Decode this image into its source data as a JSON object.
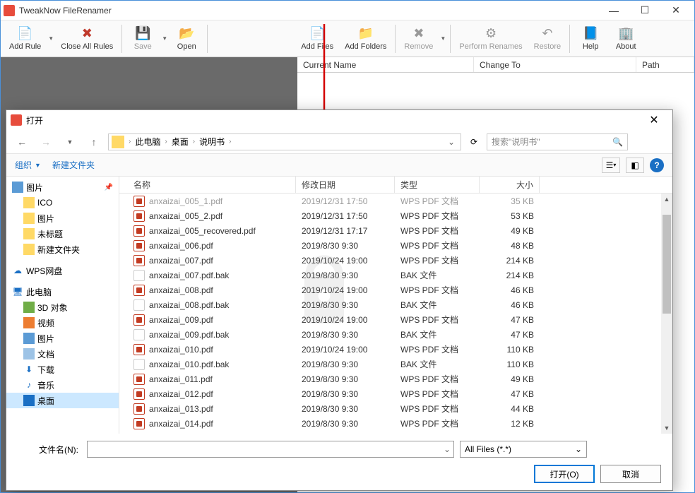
{
  "app": {
    "title": "TweakNow FileRenamer"
  },
  "toolbar": {
    "add_rule": "Add Rule",
    "close_all": "Close All Rules",
    "save": "Save",
    "open": "Open",
    "add_files": "Add Files",
    "add_folders": "Add Folders",
    "remove": "Remove",
    "perform": "Perform Renames",
    "restore": "Restore",
    "help": "Help",
    "about": "About"
  },
  "columns": {
    "current_name": "Current Name",
    "change_to": "Change To",
    "path": "Path"
  },
  "dialog": {
    "title": "打开",
    "breadcrumb": [
      "此电脑",
      "桌面",
      "说明书"
    ],
    "search_placeholder": "搜索\"说明书\"",
    "organize": "组织",
    "new_folder": "新建文件夹",
    "sidebar": {
      "pictures_pin": "图片",
      "ico": "ICO",
      "pictures": "图片",
      "untitled": "未标题",
      "new_folder": "新建文件夹",
      "wps": "WPS网盘",
      "this_pc": "此电脑",
      "objects3d": "3D 对象",
      "videos": "视频",
      "pictures2": "图片",
      "documents": "文档",
      "downloads": "下载",
      "music": "音乐",
      "desktop": "桌面"
    },
    "headers": {
      "name": "名称",
      "date": "修改日期",
      "type": "类型",
      "size": "大小"
    },
    "files": [
      {
        "name": "anxaizai_005_1.pdf",
        "date": "2019/12/31 17:50",
        "type": "WPS PDF 文档",
        "size": "35 KB",
        "icon": "pdf",
        "cut": true
      },
      {
        "name": "anxaizai_005_2.pdf",
        "date": "2019/12/31 17:50",
        "type": "WPS PDF 文档",
        "size": "53 KB",
        "icon": "pdf"
      },
      {
        "name": "anxaizai_005_recovered.pdf",
        "date": "2019/12/31 17:17",
        "type": "WPS PDF 文档",
        "size": "49 KB",
        "icon": "pdf"
      },
      {
        "name": "anxaizai_006.pdf",
        "date": "2019/8/30 9:30",
        "type": "WPS PDF 文档",
        "size": "48 KB",
        "icon": "pdf"
      },
      {
        "name": "anxaizai_007.pdf",
        "date": "2019/10/24 19:00",
        "type": "WPS PDF 文档",
        "size": "214 KB",
        "icon": "pdf"
      },
      {
        "name": "anxaizai_007.pdf.bak",
        "date": "2019/8/30 9:30",
        "type": "BAK 文件",
        "size": "214 KB",
        "icon": "bak"
      },
      {
        "name": "anxaizai_008.pdf",
        "date": "2019/10/24 19:00",
        "type": "WPS PDF 文档",
        "size": "46 KB",
        "icon": "pdf"
      },
      {
        "name": "anxaizai_008.pdf.bak",
        "date": "2019/8/30 9:30",
        "type": "BAK 文件",
        "size": "46 KB",
        "icon": "bak"
      },
      {
        "name": "anxaizai_009.pdf",
        "date": "2019/10/24 19:00",
        "type": "WPS PDF 文档",
        "size": "47 KB",
        "icon": "pdf"
      },
      {
        "name": "anxaizai_009.pdf.bak",
        "date": "2019/8/30 9:30",
        "type": "BAK 文件",
        "size": "47 KB",
        "icon": "bak"
      },
      {
        "name": "anxaizai_010.pdf",
        "date": "2019/10/24 19:00",
        "type": "WPS PDF 文档",
        "size": "110 KB",
        "icon": "pdf"
      },
      {
        "name": "anxaizai_010.pdf.bak",
        "date": "2019/8/30 9:30",
        "type": "BAK 文件",
        "size": "110 KB",
        "icon": "bak"
      },
      {
        "name": "anxaizai_011.pdf",
        "date": "2019/8/30 9:30",
        "type": "WPS PDF 文档",
        "size": "49 KB",
        "icon": "pdf"
      },
      {
        "name": "anxaizai_012.pdf",
        "date": "2019/8/30 9:30",
        "type": "WPS PDF 文档",
        "size": "47 KB",
        "icon": "pdf"
      },
      {
        "name": "anxaizai_013.pdf",
        "date": "2019/8/30 9:30",
        "type": "WPS PDF 文档",
        "size": "44 KB",
        "icon": "pdf"
      },
      {
        "name": "anxaizai_014.pdf",
        "date": "2019/8/30 9:30",
        "type": "WPS PDF 文档",
        "size": "12 KB",
        "icon": "pdf"
      }
    ],
    "filename_label": "文件名(N):",
    "filter": "All Files (*.*)",
    "open_btn": "打开(O)",
    "cancel_btn": "取消"
  }
}
